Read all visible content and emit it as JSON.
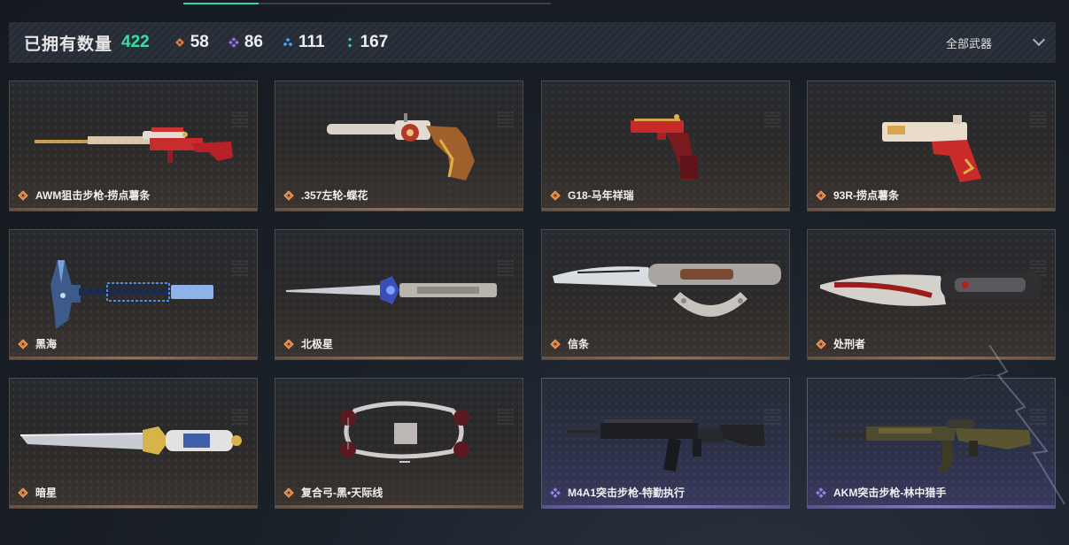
{
  "summary": {
    "owned_label": "已拥有数量",
    "owned_total": "422",
    "rarity_counts": [
      {
        "name": "orange-rarity",
        "value": "58",
        "color": "#e07a3a"
      },
      {
        "name": "purple-rarity",
        "value": "86",
        "color": "#9d6ef0"
      },
      {
        "name": "blue-rarity",
        "value": "111",
        "color": "#4aa3f0"
      },
      {
        "name": "green-rarity",
        "value": "167",
        "color": "#2fd6a8"
      }
    ],
    "filter_label": "全部武器"
  },
  "weapons": [
    {
      "name": "AWM狙击步枪-捞点薯条",
      "rarity": "orange"
    },
    {
      "name": ".357左轮-蝶花",
      "rarity": "orange"
    },
    {
      "name": "G18-马年祥瑞",
      "rarity": "orange"
    },
    {
      "name": "93R-捞点薯条",
      "rarity": "orange"
    },
    {
      "name": "黑海",
      "rarity": "orange"
    },
    {
      "name": "北极星",
      "rarity": "orange"
    },
    {
      "name": "信条",
      "rarity": "orange"
    },
    {
      "name": "处刑者",
      "rarity": "orange"
    },
    {
      "name": "暗星",
      "rarity": "orange"
    },
    {
      "name": "复合弓-黑•天际线",
      "rarity": "orange"
    },
    {
      "name": "M4A1突击步枪-特勤执行",
      "rarity": "purple"
    },
    {
      "name": "AKM突击步枪-林中猎手",
      "rarity": "purple"
    }
  ]
}
